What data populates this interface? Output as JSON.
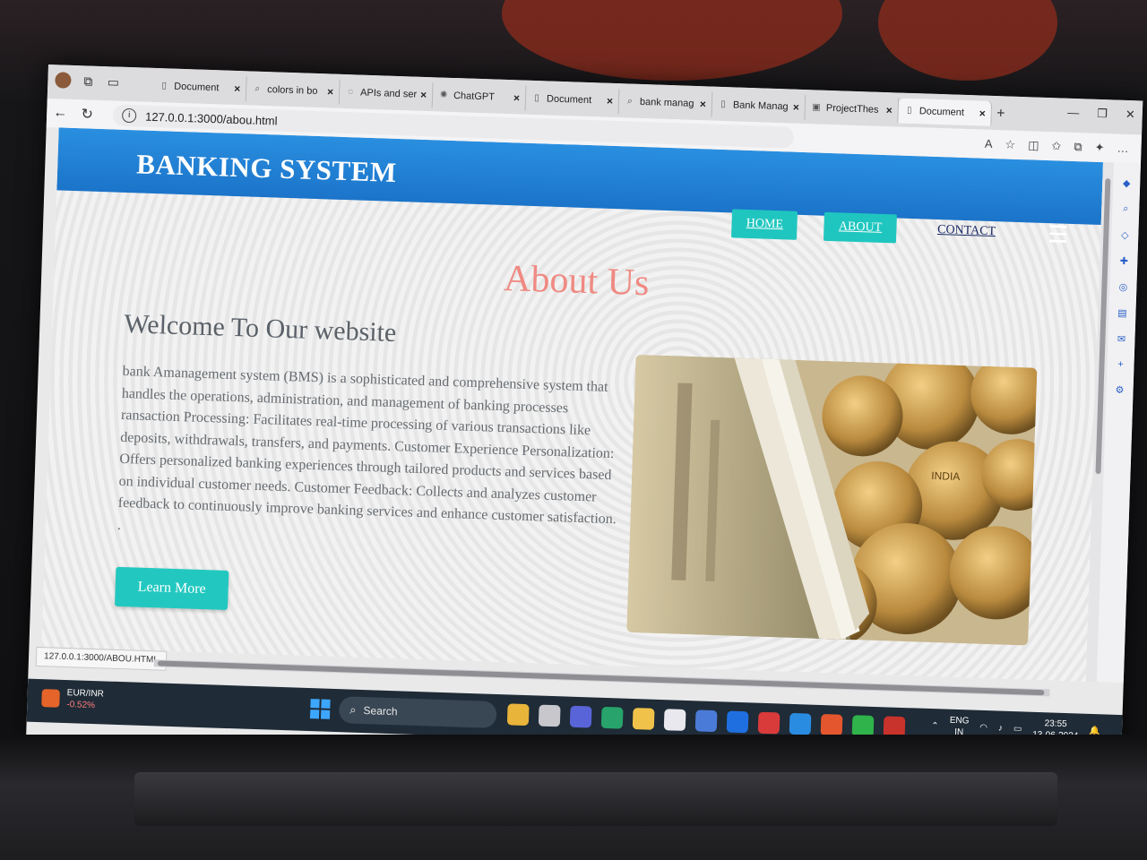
{
  "browser": {
    "tabs": [
      {
        "label": "Document",
        "icon": "document-icon",
        "active": false
      },
      {
        "label": "colors in bo",
        "icon": "search-icon",
        "active": false
      },
      {
        "label": "APIs and ser",
        "icon": "api-icon",
        "active": false
      },
      {
        "label": "ChatGPT",
        "icon": "chatgpt-icon",
        "active": false
      },
      {
        "label": "Document",
        "icon": "document-icon",
        "active": false
      },
      {
        "label": "bank manag",
        "icon": "search-icon",
        "active": false
      },
      {
        "label": "Bank Manag",
        "icon": "document-icon",
        "active": false
      },
      {
        "label": "ProjectThes",
        "icon": "pdf-icon",
        "active": false
      },
      {
        "label": "Document",
        "icon": "document-icon",
        "active": true
      }
    ],
    "url": "127.0.0.1:3000/abou.html",
    "status_url": "127.0.0.1:3000/ABOU.HTML"
  },
  "site": {
    "brand": "BANKING SYSTEM",
    "nav": [
      {
        "label": "HOME",
        "style": "btn"
      },
      {
        "label": "ABOUT",
        "style": "btn"
      },
      {
        "label": "CONTACT",
        "style": "plain"
      }
    ],
    "about_title": "About Us",
    "welcome_heading": "Welcome To Our website",
    "paragraph": "bank Amanagement system (BMS) is a sophisticated and comprehensive system that handles the operations, administration, and management of banking processes ransaction Processing: Facilitates real-time processing of various transactions like deposits, withdrawals, transfers, and payments. Customer Experience Personalization: Offers personalized banking experiences through tailored products and services based on individual customer needs. Customer Feedback: Collects and analyzes customer feedback to continuously improve banking services and enhance customer satisfaction. .",
    "learn_more": "Learn More",
    "image_caption": "INDIA"
  },
  "taskbar": {
    "widget_name": "EUR/INR",
    "widget_change": "-0.52%",
    "search_label": "Search",
    "lang_line1": "ENG",
    "lang_line2": "IN",
    "time": "23:55",
    "date": "13-06-2024"
  },
  "colors": {
    "header_blue": "#1b74c9",
    "teal_button": "#22c8c0",
    "about_title": "#ef8a83"
  }
}
